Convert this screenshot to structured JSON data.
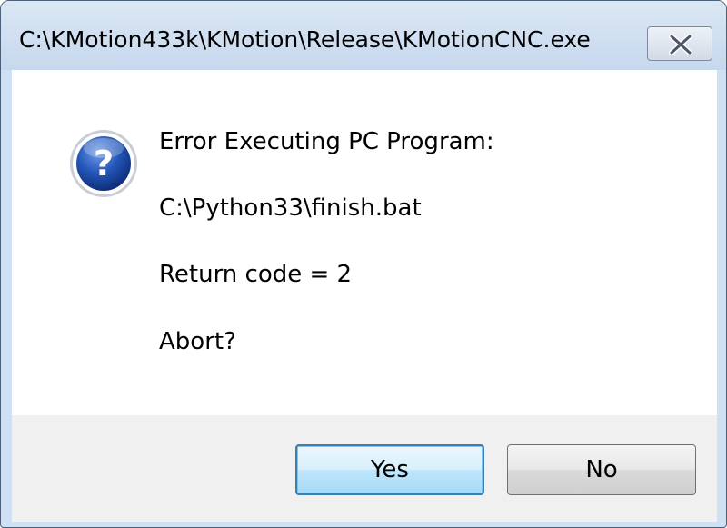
{
  "window": {
    "title": "C:\\KMotion433k\\KMotion\\Release\\KMotionCNC.exe",
    "close_icon": "close-icon"
  },
  "dialog": {
    "icon": "question-icon",
    "lines": [
      "Error Executing PC Program:",
      "C:\\Python33\\finish.bat",
      "Return code = 2",
      "Abort?"
    ]
  },
  "buttons": {
    "yes_label": "Yes",
    "no_label": "No"
  },
  "colors": {
    "titlebar": "#c6d8ee",
    "default_button_border": "#3c7fb1",
    "icon_blue": "#1f4fa8"
  }
}
